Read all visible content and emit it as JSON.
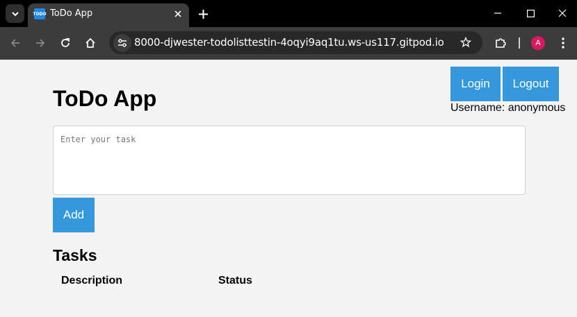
{
  "browser": {
    "tab_title": "ToDo App",
    "favicon_text": "TODO",
    "url": "8000-djwester-todolisttestin-4oqyi9aq1tu.ws-us117.gitpod.io",
    "profile_initial": "A"
  },
  "app": {
    "title": "ToDo App",
    "login_label": "Login",
    "logout_label": "Logout",
    "username_text": "Username: anonymous",
    "task_placeholder": "Enter your task",
    "add_label": "Add",
    "tasks_heading": "Tasks",
    "columns": [
      "Description",
      "Status"
    ]
  }
}
